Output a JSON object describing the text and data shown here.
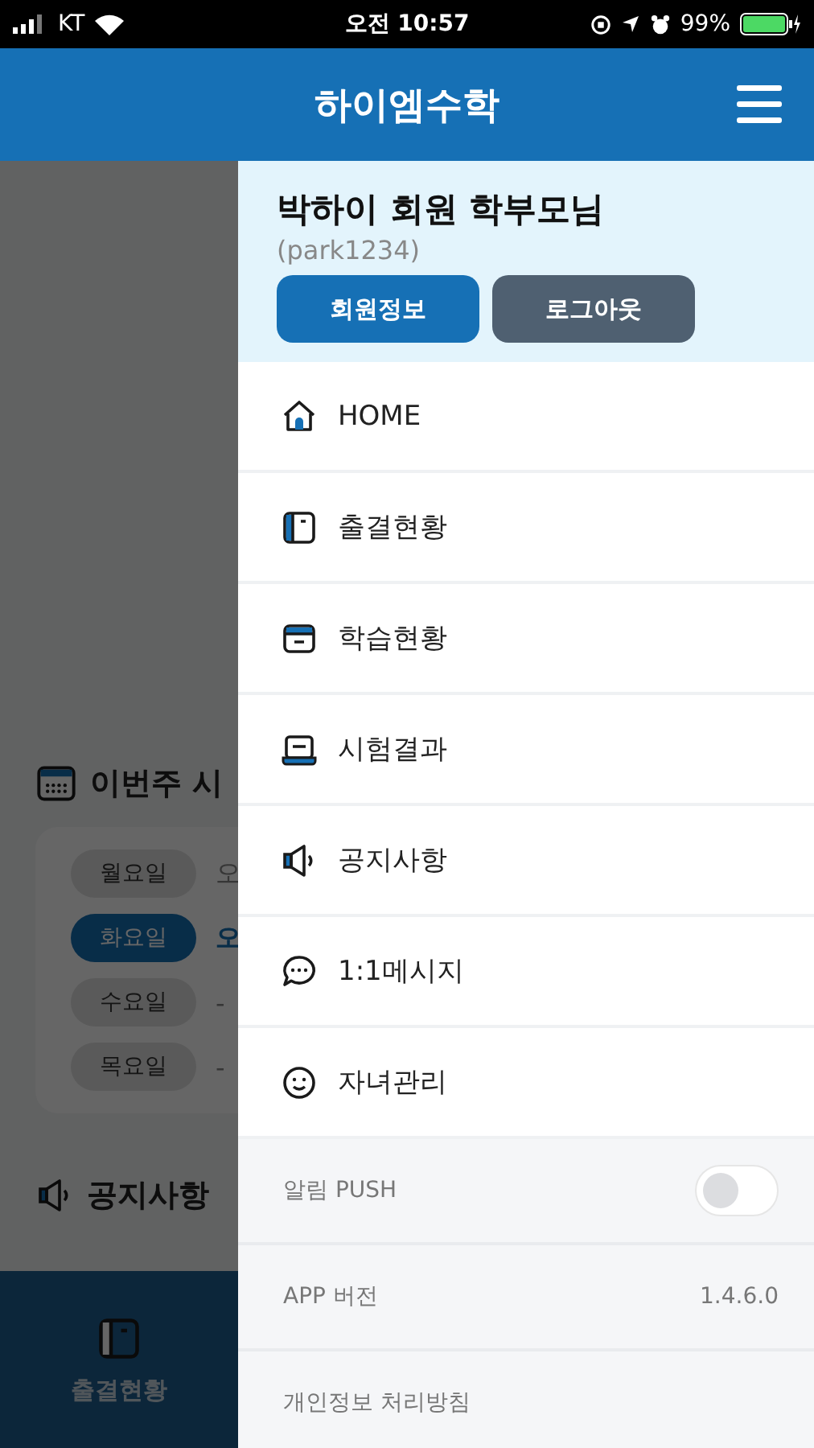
{
  "status_bar": {
    "carrier": "KT",
    "time": "오전 10:57",
    "battery": "99%"
  },
  "header": {
    "title": "하이엠수학"
  },
  "background": {
    "schedule_title": "이번주 시",
    "days": [
      {
        "label": "월요일",
        "value": "오",
        "selected": false
      },
      {
        "label": "화요일",
        "value": "오",
        "selected": true
      },
      {
        "label": "수요일",
        "value": "-",
        "selected": false
      },
      {
        "label": "목요일",
        "value": "-",
        "selected": false
      }
    ],
    "notice_title": "공지사항",
    "tab_bar": [
      {
        "label": "출결현황"
      }
    ]
  },
  "drawer": {
    "user_name": "박하이 회원 학부모님",
    "user_id": "(park1234)",
    "buttons": [
      {
        "label": "회원정보",
        "kind": "primary"
      },
      {
        "label": "로그아웃",
        "kind": "secondary"
      }
    ],
    "menu": [
      {
        "label": "HOME"
      },
      {
        "label": "출결현황"
      },
      {
        "label": "학습현황"
      },
      {
        "label": "시험결과"
      },
      {
        "label": "공지사항"
      },
      {
        "label": "1:1메시지"
      },
      {
        "label": "자녀관리"
      }
    ],
    "settings": [
      {
        "kind": "toggle",
        "label": "알림 PUSH",
        "on": false
      },
      {
        "kind": "value",
        "label": "APP 버전",
        "value": "1.4.6.0"
      },
      {
        "kind": "link",
        "label": "개인정보 처리방침"
      }
    ]
  }
}
